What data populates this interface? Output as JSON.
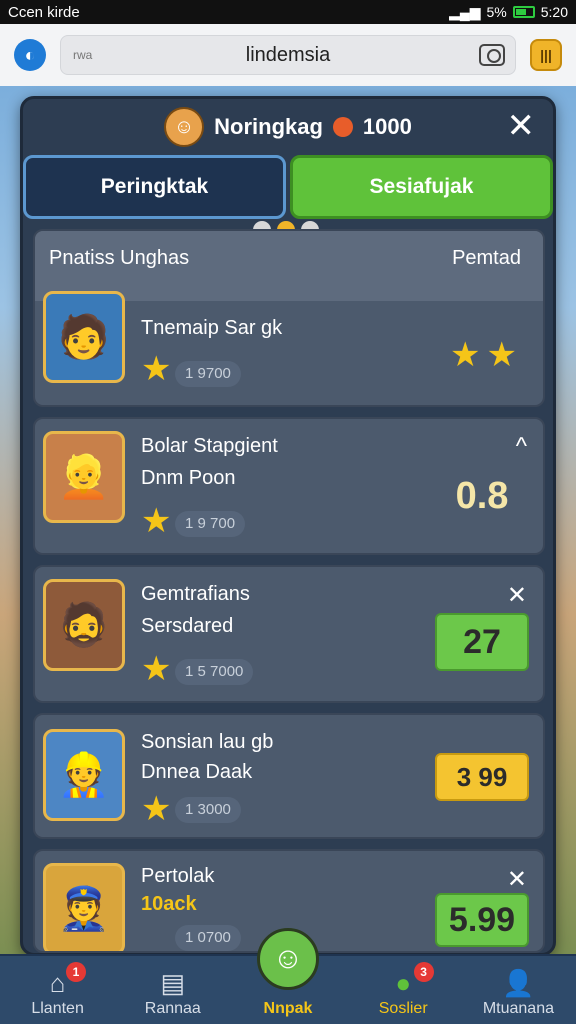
{
  "status_bar": {
    "left_text": "Ccen kirde",
    "right_text": "5%",
    "time": "5:20"
  },
  "browser": {
    "url_prefix": "rwa",
    "url_text": "lindemsia",
    "camera_icon": "camera-icon",
    "menu_icon": "menu-icon"
  },
  "panel": {
    "title": "Noringkag",
    "coins": "1000",
    "close_symbol": "✕",
    "tabs": [
      {
        "label": "Peringktak",
        "active": true
      },
      {
        "label": "Sesiafujak",
        "active": false
      }
    ],
    "page_dots": 3,
    "active_dot": 1
  },
  "leaderboard": {
    "header_left": "Pnatiss Unghas",
    "header_right": "Pemtad",
    "rows": [
      {
        "name1": "Tnemaip Sar gk",
        "name2": "",
        "points": "1 9700",
        "score": "",
        "stars": "★★",
        "control": ""
      },
      {
        "name1": "Bolar Stapgient",
        "name2": "Dnm Poon",
        "points": "1 9 700",
        "score": "0.8",
        "control": "^"
      },
      {
        "name1": "Gemtrafians",
        "name2": "Sersdared",
        "points": "1 5 7000",
        "score": "27",
        "control": "✕"
      },
      {
        "name1": "Sonsian lau gb",
        "name2": "Dnnea Daak",
        "points": "1 3000",
        "score": "3 99",
        "control": ""
      },
      {
        "name1": "Pertolak",
        "name2": "10ack",
        "points": "1 0700",
        "score": "5.99",
        "control": "✕"
      }
    ]
  },
  "bottom_nav": {
    "items": [
      {
        "label": "Llanten",
        "badge": "1"
      },
      {
        "label": "Rannaa",
        "badge": ""
      },
      {
        "label": "Nnpak",
        "badge": ""
      },
      {
        "label": "Soslier",
        "badge": "3"
      },
      {
        "label": "Mtuanana",
        "badge": ""
      }
    ]
  },
  "colors": {
    "accent_green": "#5fc23a",
    "accent_yellow": "#f4c430",
    "panel_bg": "#2d3d52"
  }
}
